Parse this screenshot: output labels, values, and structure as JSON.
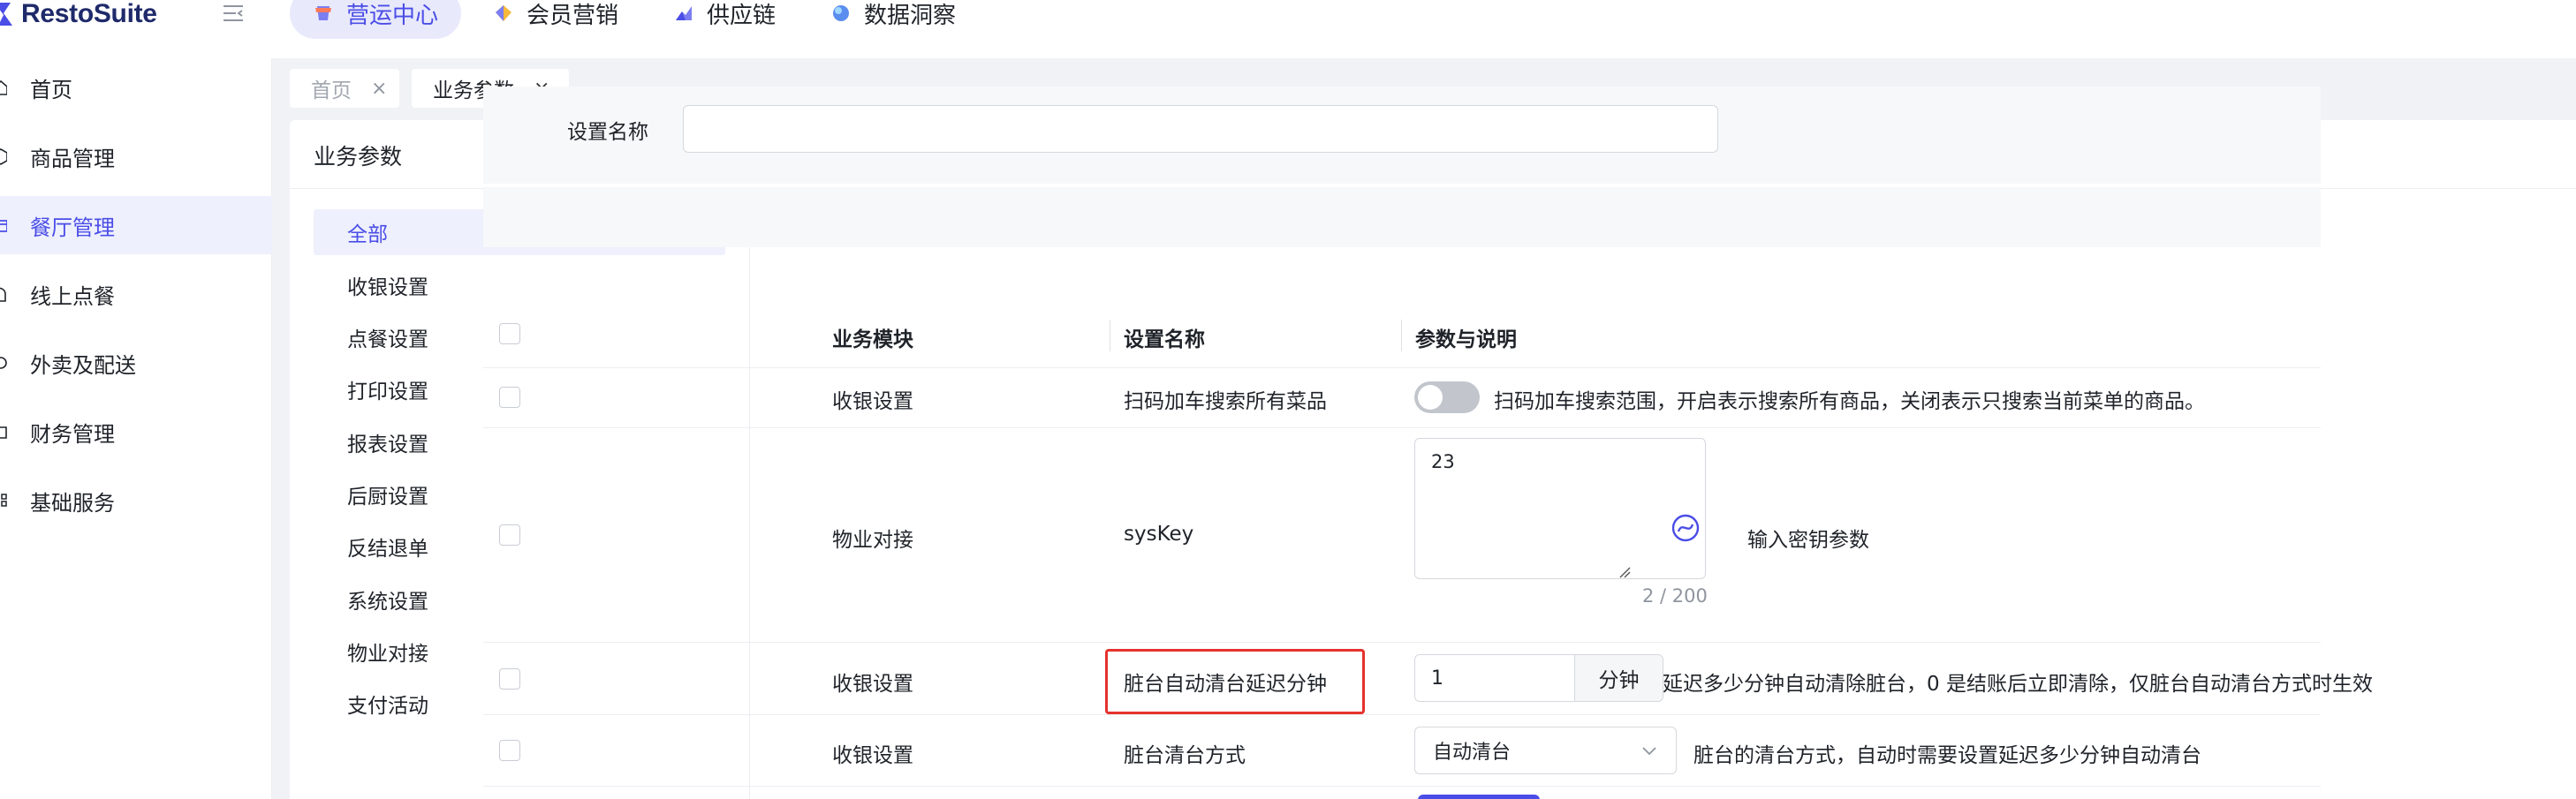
{
  "app": {
    "logo_text": "RestoSuite"
  },
  "topnav": [
    {
      "label": "营运中心",
      "icon": "shop-icon",
      "active": true
    },
    {
      "label": "会员营销",
      "icon": "diamond-icon",
      "active": false
    },
    {
      "label": "供应链",
      "icon": "chart-icon",
      "active": false
    },
    {
      "label": "数据洞察",
      "icon": "globe-icon",
      "active": false
    }
  ],
  "sidebar": {
    "items": [
      {
        "label": "首页",
        "icon": "home-icon"
      },
      {
        "label": "商品管理",
        "icon": "box-icon"
      },
      {
        "label": "餐厅管理",
        "icon": "store-icon",
        "active": true
      },
      {
        "label": "线上点餐",
        "icon": "hand-icon"
      },
      {
        "label": "外卖及配送",
        "icon": "delivery-icon"
      },
      {
        "label": "财务管理",
        "icon": "wallet-icon"
      },
      {
        "label": "基础服务",
        "icon": "grid-icon"
      }
    ]
  },
  "tabs": [
    {
      "label": "首页",
      "close": "×"
    },
    {
      "label": "业务参数",
      "close": "×"
    }
  ],
  "page": {
    "title": "业务参数"
  },
  "categories": [
    "全部",
    "收银设置",
    "点餐设置",
    "打印设置",
    "报表设置",
    "后厨设置",
    "反结退单",
    "系统设置",
    "物业对接",
    "支付活动"
  ],
  "filter": {
    "label": "设置名称",
    "value": ""
  },
  "table": {
    "headers": [
      "业务模块",
      "设置名称",
      "参数与说明"
    ],
    "rows": [
      {
        "module": "收银设置",
        "name": "扫码加车搜索所有菜品",
        "desc": "扫码加车搜索范围，开启表示搜索所有商品，关闭表示只搜索当前菜单的商品。",
        "toggle_on": false
      },
      {
        "module": "物业对接",
        "name": "sysKey",
        "value": "23",
        "counter": "2 / 200",
        "desc": "输入密钥参数"
      },
      {
        "module": "收银设置",
        "name": "脏台自动清台延迟分钟",
        "value": "1",
        "suffix": "分钟",
        "desc": "延迟多少分钟自动清除脏台，0 是结账后立即清除，仅脏台自动清台方式时生效",
        "highlighted": true
      },
      {
        "module": "收银设置",
        "name": "脏台清台方式",
        "value": "自动清台",
        "desc": "脏台的清台方式，自动时需要设置延迟多少分钟自动清台"
      }
    ]
  },
  "colors": {
    "accent": "#4a4de6",
    "highlight": "#e5322d"
  }
}
